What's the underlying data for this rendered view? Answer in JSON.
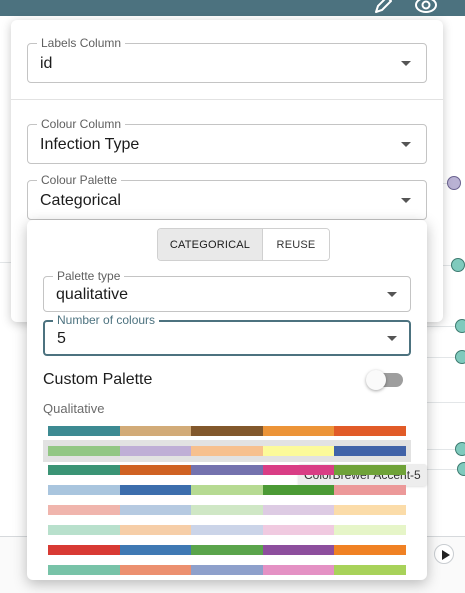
{
  "panel": {
    "labels_column": {
      "label": "Labels Column",
      "value": "id"
    },
    "colour_column": {
      "label": "Colour Column",
      "value": "Infection Type"
    },
    "colour_palette": {
      "label": "Colour Palette",
      "value": "Categorical"
    }
  },
  "popup": {
    "mode_tabs": [
      {
        "label": "CATEGORICAL",
        "selected": true
      },
      {
        "label": "REUSE",
        "selected": false
      }
    ],
    "palette_type": {
      "label": "Palette type",
      "value": "qualitative"
    },
    "number_of_colours": {
      "label": "Number of colours",
      "value": "5"
    },
    "custom_palette": {
      "label": "Custom Palette",
      "enabled": false
    },
    "section_heading": "Qualitative",
    "palettes": [
      {
        "colors": [
          "#3d8a92",
          "#d2ab78",
          "#82582c",
          "#ec9438",
          "#e15b28"
        ],
        "highlighted": false
      },
      {
        "colors": [
          "#92c784",
          "#bfaed6",
          "#f7c08e",
          "#fcfa9a",
          "#4163a8"
        ],
        "highlighted": true
      },
      {
        "colors": [
          "#3b9475",
          "#cf6223",
          "#7472ae",
          "#d93d85",
          "#6fa238"
        ],
        "highlighted": false
      },
      {
        "colors": [
          "#a9c5de",
          "#3c6ead",
          "#b6da92",
          "#4b9a35",
          "#ec9999"
        ],
        "highlighted": false
      },
      {
        "colors": [
          "#f0b5ad",
          "#b6cae1",
          "#cfe7c5",
          "#ddcbe3",
          "#fbdca9"
        ],
        "highlighted": false
      },
      {
        "colors": [
          "#b8e0cc",
          "#f6cea8",
          "#cbd4e8",
          "#f0cae0",
          "#e6f5c8"
        ],
        "highlighted": false
      },
      {
        "colors": [
          "#d83a34",
          "#3f79b4",
          "#5aa44b",
          "#8d4e9d",
          "#f08123"
        ],
        "highlighted": false
      },
      {
        "colors": [
          "#78c3a8",
          "#ec9070",
          "#8ea0cb",
          "#e491c4",
          "#a8d25a"
        ],
        "highlighted": false
      }
    ],
    "tooltip": "ColorBrewer Accent-5"
  },
  "icons": {
    "edit": "pencil-icon",
    "visibility": "eye-icon",
    "play": "play-icon"
  },
  "colors": {
    "topbar": "#4c727f",
    "node_purple": "#b9b2d4",
    "node_teal": "#7fcabd"
  }
}
